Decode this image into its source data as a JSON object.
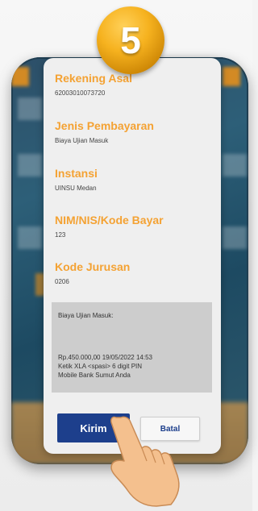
{
  "step_badge": "5",
  "dialog": {
    "fields": [
      {
        "label": "Rekening Asal",
        "value": "62003010073720"
      },
      {
        "label": "Jenis Pembayaran",
        "value": "Biaya Ujian Masuk"
      },
      {
        "label": "Instansi",
        "value": "UINSU Medan"
      },
      {
        "label": "NIM/NIS/Kode Bayar",
        "value": "123"
      },
      {
        "label": "Kode Jurusan",
        "value": "0206"
      }
    ],
    "info": {
      "title": "Biaya Ujian Masuk:",
      "amount_line": "Rp.450.000,00  19/05/2022 14:53",
      "instruction_line1": "Ketik XLA <spasi> 6 digit PIN",
      "instruction_line2": "Mobile Bank Sumut Anda"
    },
    "buttons": {
      "submit": "Kirim",
      "cancel": "Batal"
    }
  },
  "colors": {
    "label": "#f4a233",
    "primary_button": "#1d3f8c",
    "badge": "#f6b21f"
  }
}
